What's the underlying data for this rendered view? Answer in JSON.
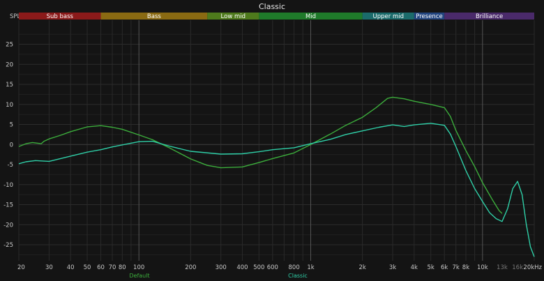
{
  "title": "Classic",
  "chart_data": {
    "type": "line",
    "title": "Classic",
    "ylabel": "SPL",
    "xscale": "log",
    "xlim": [
      20,
      20000
    ],
    "ylim": [
      -29,
      31
    ],
    "grid": true,
    "y_ticks": [
      -25,
      -20,
      -15,
      -10,
      -5,
      0,
      5,
      10,
      15,
      20,
      25
    ],
    "x_ticks": [
      {
        "value": 20,
        "label": "20"
      },
      {
        "value": 30,
        "label": "30"
      },
      {
        "value": 40,
        "label": "40"
      },
      {
        "value": 50,
        "label": "50"
      },
      {
        "value": 60,
        "label": "60"
      },
      {
        "value": 70,
        "label": "70"
      },
      {
        "value": 80,
        "label": "80"
      },
      {
        "value": 100,
        "label": "100"
      },
      {
        "value": 200,
        "label": "200"
      },
      {
        "value": 300,
        "label": "300"
      },
      {
        "value": 400,
        "label": "400"
      },
      {
        "value": 500,
        "label": "500"
      },
      {
        "value": 600,
        "label": "600"
      },
      {
        "value": 800,
        "label": "800"
      },
      {
        "value": 1000,
        "label": "1k"
      },
      {
        "value": 2000,
        "label": "2k"
      },
      {
        "value": 3000,
        "label": "3k"
      },
      {
        "value": 4000,
        "label": "4k"
      },
      {
        "value": 5000,
        "label": "5k"
      },
      {
        "value": 6000,
        "label": "6k"
      },
      {
        "value": 7000,
        "label": "7k"
      },
      {
        "value": 8000,
        "label": "8k"
      },
      {
        "value": 10000,
        "label": "10k"
      },
      {
        "value": 13000,
        "label": "13k",
        "dim": true
      },
      {
        "value": 16000,
        "label": "16k",
        "dim": true
      },
      {
        "value": 20000,
        "label": "20kHz"
      }
    ],
    "bands": [
      {
        "name": "Sub bass",
        "from": 20,
        "to": 60,
        "color": "#8b1a1a"
      },
      {
        "name": "Bass",
        "from": 60,
        "to": 250,
        "color": "#8a6a12"
      },
      {
        "name": "Low mid",
        "from": 250,
        "to": 500,
        "color": "#4e7a1c"
      },
      {
        "name": "Mid",
        "from": 500,
        "to": 2000,
        "color": "#1f7a2a"
      },
      {
        "name": "Upper mid",
        "from": 2000,
        "to": 4000,
        "color": "#1b6b6b"
      },
      {
        "name": "Presence",
        "from": 4000,
        "to": 6000,
        "color": "#23457f"
      },
      {
        "name": "Brilliance",
        "from": 6000,
        "to": 20000,
        "color": "#4a2a6a"
      }
    ],
    "series": [
      {
        "name": "Default",
        "color": "#3cae3c",
        "points": [
          [
            20,
            -0.5
          ],
          [
            22,
            0.2
          ],
          [
            24,
            0.5
          ],
          [
            27,
            0.2
          ],
          [
            28,
            0.8
          ],
          [
            30,
            1.4
          ],
          [
            35,
            2.3
          ],
          [
            40,
            3.2
          ],
          [
            50,
            4.4
          ],
          [
            60,
            4.7
          ],
          [
            70,
            4.3
          ],
          [
            80,
            3.8
          ],
          [
            100,
            2.4
          ],
          [
            120,
            1.2
          ],
          [
            150,
            -0.8
          ],
          [
            200,
            -3.6
          ],
          [
            250,
            -5.2
          ],
          [
            300,
            -5.8
          ],
          [
            400,
            -5.6
          ],
          [
            500,
            -4.5
          ],
          [
            600,
            -3.5
          ],
          [
            800,
            -2.1
          ],
          [
            1000,
            0
          ],
          [
            1300,
            2.6
          ],
          [
            1600,
            4.8
          ],
          [
            2000,
            6.8
          ],
          [
            2400,
            9.2
          ],
          [
            2800,
            11.5
          ],
          [
            3000,
            11.8
          ],
          [
            3500,
            11.4
          ],
          [
            4000,
            10.8
          ],
          [
            5000,
            10
          ],
          [
            6000,
            9.2
          ],
          [
            6500,
            7
          ],
          [
            7000,
            3.5
          ],
          [
            8000,
            -1.5
          ],
          [
            9000,
            -5.5
          ],
          [
            10000,
            -9.5
          ],
          [
            11500,
            -14
          ],
          [
            12500,
            -16.5
          ],
          [
            13000,
            -17.2
          ]
        ]
      },
      {
        "name": "Classic",
        "color": "#2fd0a8",
        "points": [
          [
            20,
            -4.8
          ],
          [
            22,
            -4.3
          ],
          [
            25,
            -4
          ],
          [
            30,
            -4.2
          ],
          [
            35,
            -3.5
          ],
          [
            40,
            -2.9
          ],
          [
            50,
            -1.9
          ],
          [
            60,
            -1.3
          ],
          [
            70,
            -0.6
          ],
          [
            80,
            -0.1
          ],
          [
            100,
            0.7
          ],
          [
            120,
            0.8
          ],
          [
            150,
            -0.4
          ],
          [
            200,
            -1.7
          ],
          [
            300,
            -2.4
          ],
          [
            400,
            -2.3
          ],
          [
            500,
            -1.8
          ],
          [
            600,
            -1.3
          ],
          [
            800,
            -0.8
          ],
          [
            1000,
            0.2
          ],
          [
            1300,
            1.3
          ],
          [
            1600,
            2.5
          ],
          [
            2000,
            3.4
          ],
          [
            2500,
            4.3
          ],
          [
            3000,
            4.9
          ],
          [
            3500,
            4.5
          ],
          [
            4000,
            4.9
          ],
          [
            5000,
            5.3
          ],
          [
            6000,
            4.8
          ],
          [
            6500,
            2.6
          ],
          [
            7000,
            -0.5
          ],
          [
            8000,
            -6.5
          ],
          [
            9000,
            -11
          ],
          [
            10000,
            -14.2
          ],
          [
            11000,
            -17
          ],
          [
            12000,
            -18.5
          ],
          [
            13000,
            -19.2
          ],
          [
            14000,
            -16
          ],
          [
            15000,
            -11
          ],
          [
            16000,
            -9.2
          ],
          [
            17000,
            -12.5
          ],
          [
            18000,
            -20
          ],
          [
            19000,
            -25.5
          ],
          [
            20000,
            -28
          ]
        ]
      }
    ]
  }
}
